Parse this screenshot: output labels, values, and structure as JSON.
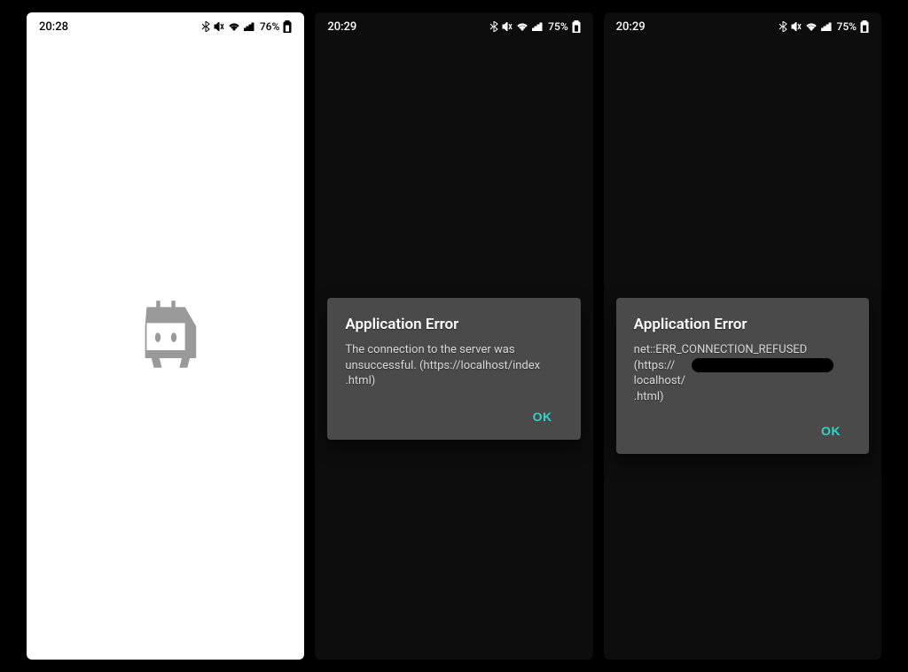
{
  "screens": [
    {
      "time": "20:28",
      "battery": "76%",
      "theme": "light",
      "dialog": null
    },
    {
      "time": "20:29",
      "battery": "75%",
      "theme": "dark",
      "dialog": {
        "title": "Application Error",
        "line1": "The connection to the server was",
        "line2": "unsuccessful. (https://localhost/index",
        "line3": ".html)",
        "ok": "OK",
        "redacted": false
      }
    },
    {
      "time": "20:29",
      "battery": "75%",
      "theme": "dark",
      "dialog": {
        "title": "Application Error",
        "line1": "net::ERR_CONNECTION_REFUSED (https://",
        "line2": "localhost/",
        "line3": ".html)",
        "ok": "OK",
        "redacted": true
      }
    }
  ],
  "colors": {
    "dialog_bg": "#4a4a4a",
    "ok_color": "#2fd4c6",
    "logo_gray": "#9a9a9a"
  }
}
